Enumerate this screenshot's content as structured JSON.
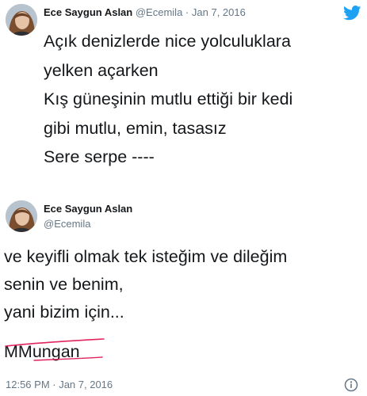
{
  "tweet1": {
    "author_name": "Ece Saygun Aslan",
    "handle": "@Ecemila",
    "separator": "·",
    "date": "Jan 7, 2016",
    "lines": [
      "Açık denizlerde nice yolculuklara",
      "yelken açarken",
      "Kış güneşinin mutlu ettiği bir kedi",
      "gibi mutlu, emin, tasasız",
      "Sere serpe ----"
    ]
  },
  "tweet2": {
    "author_name": "Ece Saygun Aslan",
    "handle": "@Ecemila",
    "lines": [
      "ve keyifli olmak tek isteğim ve dileğim",
      "senin ve benim,",
      "yani bizim için..."
    ],
    "signature": "MMungan",
    "timestamp": "12:56 PM · Jan 7, 2016"
  },
  "icons": {
    "brand_icon": "twitter-bird-icon",
    "info_icon": "info-icon"
  },
  "colors": {
    "twitter_blue": "#1da1f2",
    "text": "#14171a",
    "muted": "#657786",
    "strike_red": "#e0245e"
  }
}
